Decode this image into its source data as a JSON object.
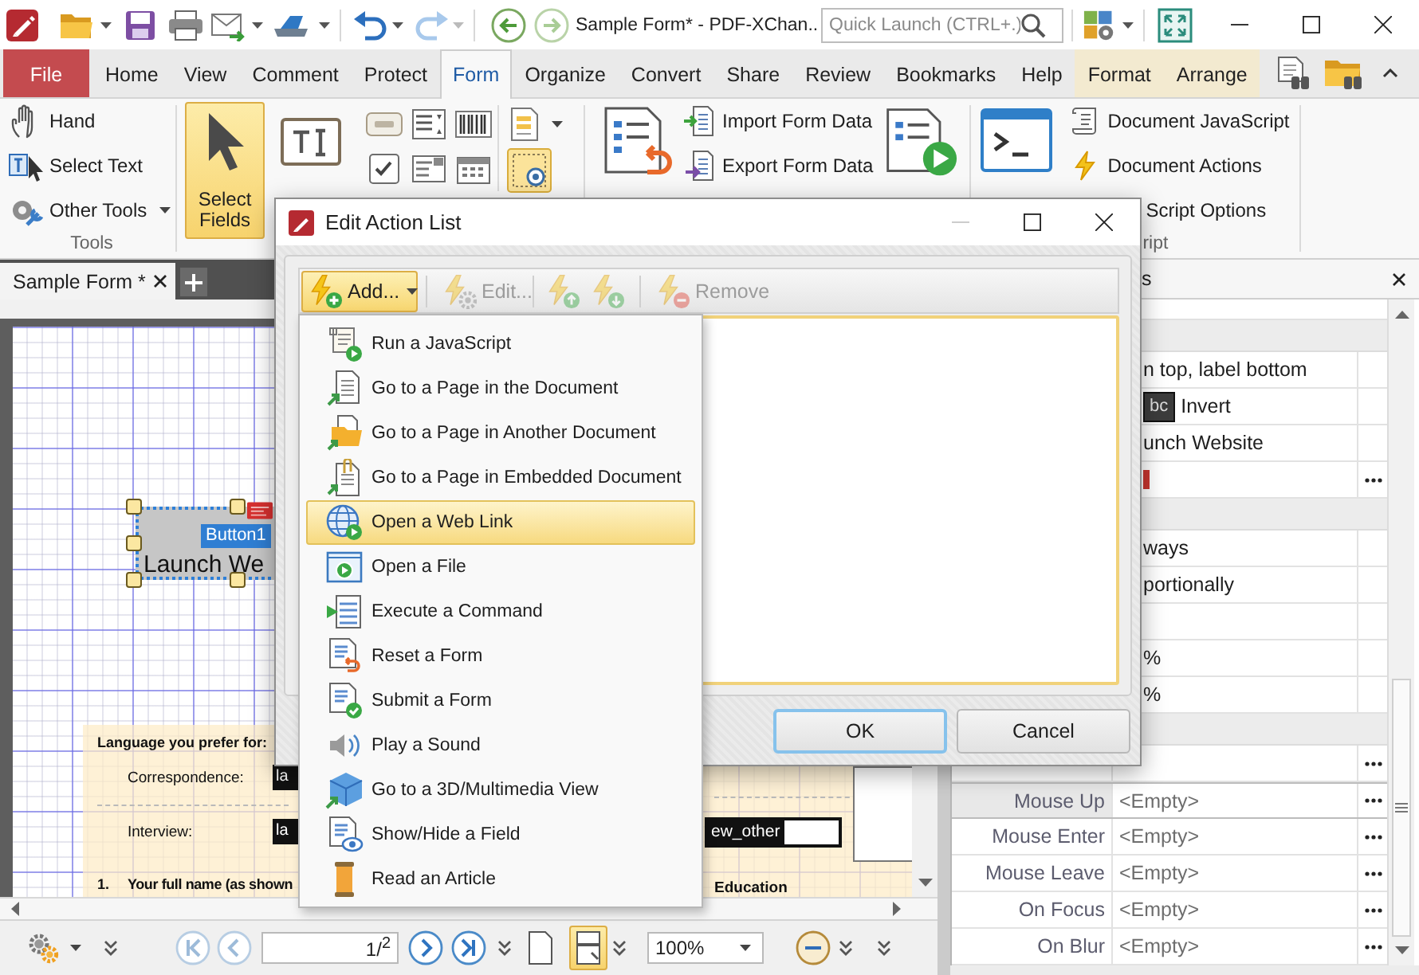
{
  "title_bar": {
    "title": "Sample Form* - PDF-XChan..",
    "quick_launch": {
      "placeholder": "Quick Launch (CTRL+.)"
    }
  },
  "ribbon_tabs": [
    {
      "label": "File",
      "kind": "file",
      "selected": false
    },
    {
      "label": "Home",
      "kind": "tab",
      "selected": false
    },
    {
      "label": "View",
      "kind": "tab",
      "selected": false
    },
    {
      "label": "Comment",
      "kind": "tab",
      "selected": false
    },
    {
      "label": "Protect",
      "kind": "tab",
      "selected": false
    },
    {
      "label": "Form",
      "kind": "tab",
      "selected": true
    },
    {
      "label": "Organize",
      "kind": "tab",
      "selected": false
    },
    {
      "label": "Convert",
      "kind": "tab",
      "selected": false
    },
    {
      "label": "Share",
      "kind": "tab",
      "selected": false
    },
    {
      "label": "Review",
      "kind": "tab",
      "selected": false
    },
    {
      "label": "Bookmarks",
      "kind": "tab",
      "selected": false
    },
    {
      "label": "Help",
      "kind": "tab",
      "selected": false
    },
    {
      "label": "Format",
      "kind": "context",
      "selected": false
    },
    {
      "label": "Arrange",
      "kind": "context",
      "selected": false
    }
  ],
  "ribbon": {
    "tools": {
      "items": [
        {
          "label": "Hand",
          "kind": "hand"
        },
        {
          "label": "Select Text",
          "kind": "select_text"
        },
        {
          "label": "Other Tools",
          "kind": "other_tools"
        }
      ],
      "label": "Tools"
    },
    "select_fields": {
      "label": "Select Fields",
      "selected": true
    },
    "highlight_fields": {
      "selected": true
    },
    "form_data": [
      {
        "label": "Import Form Data",
        "kind": "import"
      },
      {
        "label": "Export Form Data",
        "kind": "export"
      }
    ],
    "scripts": {
      "items": [
        {
          "label": "Document JavaScript",
          "kind": "document_js"
        },
        {
          "label": "Document Actions",
          "kind": "actions"
        },
        {
          "label": "Script Options",
          "kind": "options"
        }
      ],
      "label": "ript"
    }
  },
  "document": {
    "tab": {
      "title": "Sample Form *"
    },
    "button_field": {
      "caption": "Launch We",
      "name": "Button1",
      "selected": true
    },
    "section_title": "Language you prefer for:",
    "language_fields": [
      {
        "label": "Correspondence:",
        "value": "la"
      },
      {
        "label": "Interview:",
        "value": "la"
      }
    ],
    "question": {
      "number": "1.",
      "text": "Your full name (as shown"
    },
    "other_field": {
      "value": "ew_other"
    },
    "education": "Education"
  },
  "properties": {
    "title": "s",
    "rows": [
      {
        "kind": "category"
      },
      {
        "kind": "text",
        "value": "n top, label bottom"
      },
      {
        "kind": "swatch",
        "swatch": "bc",
        "value": "Invert"
      },
      {
        "kind": "text",
        "value": "unch Website"
      },
      {
        "kind": "icon"
      },
      {
        "kind": "category"
      },
      {
        "kind": "text",
        "value": "ways"
      },
      {
        "kind": "text",
        "value": "portionally"
      },
      {
        "kind": "blank"
      },
      {
        "kind": "text",
        "value": "%"
      },
      {
        "kind": "text",
        "value": "%"
      },
      {
        "kind": "category"
      },
      {
        "kind": "button"
      }
    ],
    "events": [
      {
        "name": "Mouse Up",
        "value": "<Empty>",
        "selected": true
      },
      {
        "name": "Mouse Enter",
        "value": "<Empty>",
        "selected": false
      },
      {
        "name": "Mouse Leave",
        "value": "<Empty>",
        "selected": false
      },
      {
        "name": "On Focus",
        "value": "<Empty>",
        "selected": false
      },
      {
        "name": "On Blur",
        "value": "<Empty>",
        "selected": false
      }
    ]
  },
  "dialog": {
    "title": "Edit Action List",
    "toolbar": [
      {
        "label": "Add...",
        "kind": "add",
        "disabled": false,
        "pressed": true
      },
      {
        "label": "Edit...",
        "kind": "edit",
        "disabled": true,
        "pressed": false
      },
      {
        "kind": "up",
        "disabled": true,
        "pressed": false
      },
      {
        "kind": "down",
        "disabled": true,
        "pressed": false
      },
      {
        "label": "Remove",
        "kind": "remove",
        "disabled": true,
        "pressed": false
      }
    ],
    "buttons": [
      {
        "label": "OK",
        "default": true
      },
      {
        "label": "Cancel",
        "default": false
      }
    ]
  },
  "add_menu": {
    "items": [
      {
        "label": "Run a JavaScript",
        "kind": "javascript",
        "selected": false
      },
      {
        "label": "Go to a Page in the Document",
        "kind": "page",
        "selected": false
      },
      {
        "label": "Go to a Page in Another Document",
        "kind": "other_doc",
        "selected": false
      },
      {
        "label": "Go to a Page in Embedded Document",
        "kind": "embedded",
        "selected": false
      },
      {
        "label": "Open a Web Link",
        "kind": "web",
        "selected": true
      },
      {
        "label": "Open a File",
        "kind": "file",
        "selected": false
      },
      {
        "label": "Execute a Command",
        "kind": "command",
        "selected": false
      },
      {
        "label": "Reset a Form",
        "kind": "reset",
        "selected": false
      },
      {
        "label": "Submit a Form",
        "kind": "submit",
        "selected": false
      },
      {
        "label": "Play a Sound",
        "kind": "sound",
        "selected": false
      },
      {
        "label": "Go to a 3D/Multimedia View",
        "kind": "cube",
        "selected": false
      },
      {
        "label": "Show/Hide a Field",
        "kind": "showhide",
        "selected": false
      },
      {
        "label": "Read an Article",
        "kind": "article",
        "selected": false
      }
    ]
  },
  "status_bar": {
    "page": "1/$^{2}$",
    "zoom": "100%",
    "layouts": [
      {
        "kind": "single",
        "selected": false
      },
      {
        "kind": "split",
        "selected": true
      }
    ]
  }
}
